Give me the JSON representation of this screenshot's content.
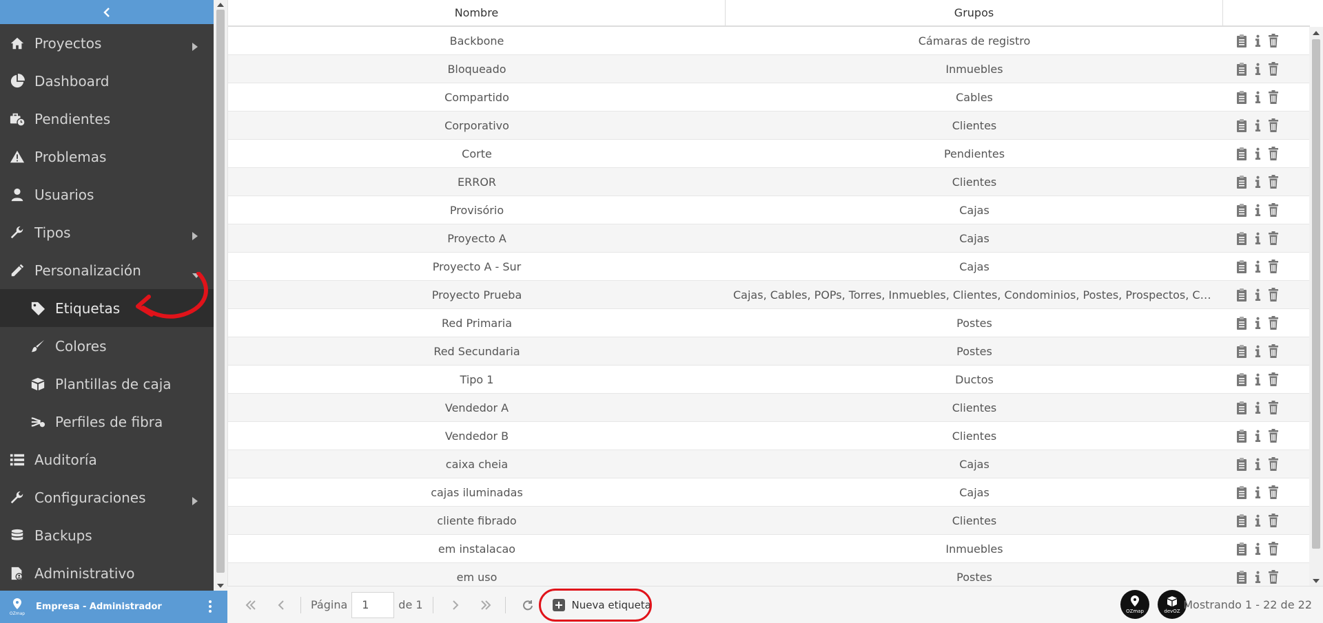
{
  "sidebar": {
    "items": [
      {
        "label": "Proyectos",
        "icon": "home-icon",
        "has_arrow": "right"
      },
      {
        "label": "Dashboard",
        "icon": "pie-chart-icon"
      },
      {
        "label": "Pendientes",
        "icon": "briefcase-clock-icon"
      },
      {
        "label": "Problemas",
        "icon": "warning-icon"
      },
      {
        "label": "Usuarios",
        "icon": "user-icon"
      },
      {
        "label": "Tipos",
        "icon": "wrench-icon",
        "has_arrow": "right"
      },
      {
        "label": "Personalización",
        "icon": "pencil-icon",
        "has_arrow": "down"
      },
      {
        "label": "Etiquetas",
        "icon": "tag-icon",
        "sub": true,
        "active": true
      },
      {
        "label": "Colores",
        "icon": "brush-icon",
        "sub": true
      },
      {
        "label": "Plantillas de caja",
        "icon": "box-icon",
        "sub": true
      },
      {
        "label": "Perfiles de fibra",
        "icon": "fiber-icon",
        "sub": true
      },
      {
        "label": "Auditoría",
        "icon": "list-icon"
      },
      {
        "label": "Configuraciones",
        "icon": "wrench-icon",
        "has_arrow": "right"
      },
      {
        "label": "Backups",
        "icon": "database-icon"
      },
      {
        "label": "Administrativo",
        "icon": "admin-document-icon"
      }
    ]
  },
  "userbar": {
    "logo_text": "OZmap",
    "name": "Empresa - Administrador"
  },
  "table": {
    "headers": [
      "Nombre",
      "Grupos",
      ""
    ],
    "rows": [
      {
        "nombre": "Backbone",
        "grupos": "Cámaras de registro"
      },
      {
        "nombre": "Bloqueado",
        "grupos": "Inmuebles"
      },
      {
        "nombre": "Compartido",
        "grupos": "Cables"
      },
      {
        "nombre": "Corporativo",
        "grupos": "Clientes"
      },
      {
        "nombre": "Corte",
        "grupos": "Pendientes"
      },
      {
        "nombre": "ERROR",
        "grupos": "Clientes"
      },
      {
        "nombre": "Provisório",
        "grupos": "Cajas"
      },
      {
        "nombre": "Proyecto A",
        "grupos": "Cajas"
      },
      {
        "nombre": "Proyecto A - Sur",
        "grupos": "Cajas"
      },
      {
        "nombre": "Proyecto Prueba",
        "grupos": "Cajas, Cables, POPs, Torres, Inmuebles, Clientes, Condominios, Postes, Prospectos, Cámaras d..."
      },
      {
        "nombre": "Red Primaria",
        "grupos": "Postes"
      },
      {
        "nombre": "Red Secundaria",
        "grupos": "Postes"
      },
      {
        "nombre": "Tipo 1",
        "grupos": "Ductos"
      },
      {
        "nombre": "Vendedor A",
        "grupos": "Clientes"
      },
      {
        "nombre": "Vendedor B",
        "grupos": "Clientes"
      },
      {
        "nombre": "caixa cheia",
        "grupos": "Cajas"
      },
      {
        "nombre": "cajas iluminadas",
        "grupos": "Cajas"
      },
      {
        "nombre": "cliente fibrado",
        "grupos": "Clientes"
      },
      {
        "nombre": "em instalacao",
        "grupos": "Inmuebles"
      },
      {
        "nombre": "em uso",
        "grupos": "Postes"
      }
    ],
    "row_actions": [
      "clipboard-icon",
      "info-icon",
      "trash-icon"
    ]
  },
  "footer": {
    "page_label": "Página",
    "page_value": "1",
    "of_label": "de 1",
    "new_button": "Nueva etiqueta",
    "brand1": "OZmap",
    "brand2": "devOZ",
    "showing": "Mostrando 1 - 22 de 22"
  },
  "colors": {
    "sidebar_bg": "#3d3d3d",
    "accent_blue": "#5b9bd5",
    "highlight_red": "#e0131a"
  }
}
